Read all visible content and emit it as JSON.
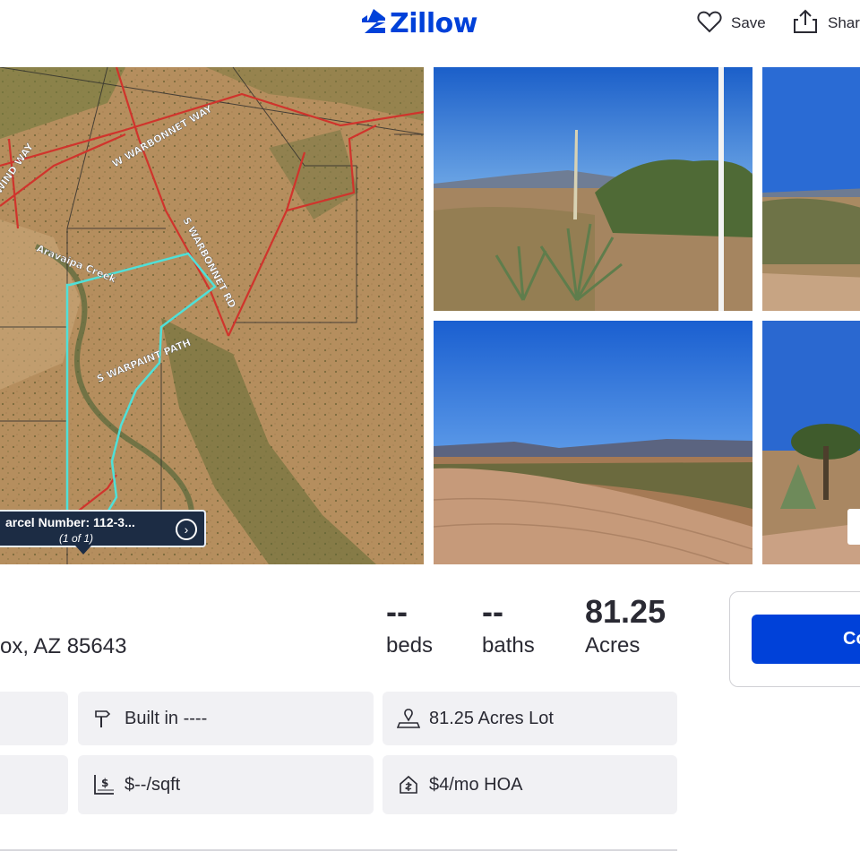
{
  "header": {
    "logo_text": "Zillow",
    "save_label": "Save",
    "share_label": "Shar"
  },
  "map": {
    "road_labels": [
      "W WARBONNET WAY",
      "WIND WAY",
      "S WARBONNET RD",
      "Aravaipa Creek",
      "S WARPAINT PATH"
    ],
    "popup_title": "arcel Number: 112-3...",
    "popup_count": "(1 of 1)"
  },
  "photos": [
    {
      "name": "Desert yucca plants with fence post"
    },
    {
      "name": "Desert fence line"
    },
    {
      "name": "Dirt road through desert"
    },
    {
      "name": "Desert trees and yucca"
    }
  ],
  "summary": {
    "address_partial": "ox, AZ 85643",
    "beds_value": "--",
    "beds_label": "beds",
    "baths_value": "--",
    "baths_label": "baths",
    "acres_value": "81.25",
    "acres_label": "Acres"
  },
  "contact": {
    "button_label": "Co"
  },
  "facts": {
    "built_in": "Built in ----",
    "lot": "81.25 Acres Lot",
    "price_per_sqft": "$--/sqft",
    "hoa": "$4/mo HOA"
  },
  "colors": {
    "brand": "#0041d9",
    "text": "#2a2a33",
    "fact_bg": "#f1f1f4",
    "parcel_outline": "#4fe0d8",
    "road_red": "#d0342c"
  }
}
